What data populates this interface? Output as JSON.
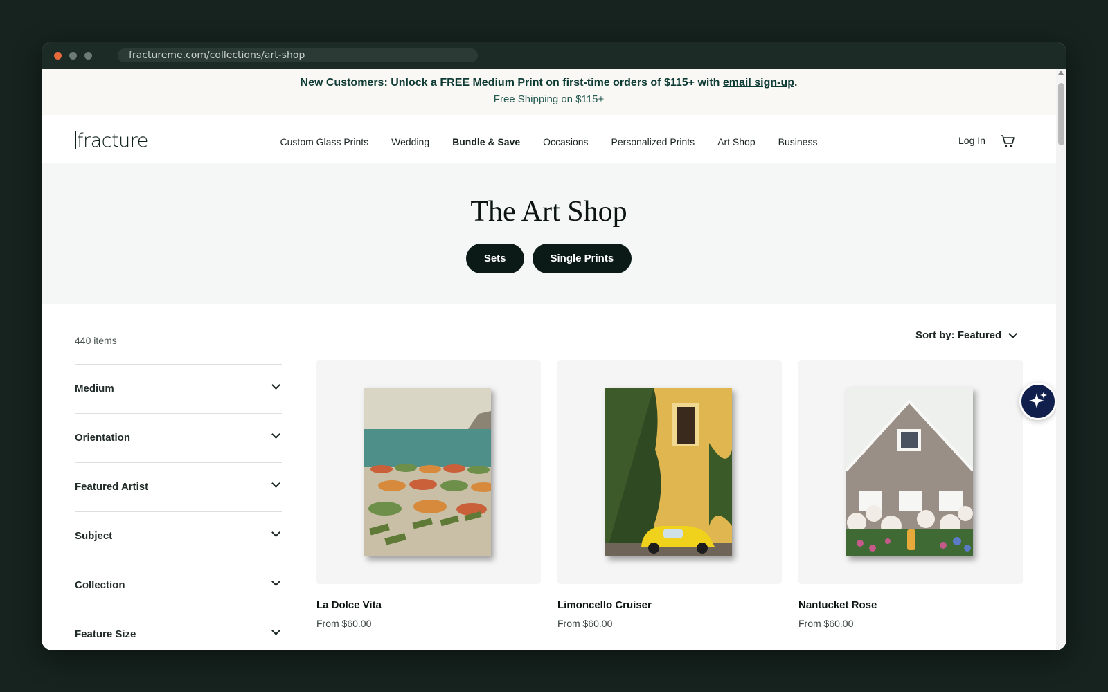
{
  "browser": {
    "url": "fractureme.com/collections/art-shop"
  },
  "promo": {
    "text_before": "New Customers: Unlock a FREE Medium Print on first-time orders of $115+ with ",
    "link": "email sign-up",
    "text_after": ".",
    "shipping": "Free Shipping on $115+"
  },
  "nav": {
    "logo": "fracture",
    "items": [
      {
        "label": "Custom Glass Prints"
      },
      {
        "label": "Wedding"
      },
      {
        "label": "Bundle & Save"
      },
      {
        "label": "Occasions"
      },
      {
        "label": "Personalized Prints"
      },
      {
        "label": "Art Shop"
      },
      {
        "label": "Business"
      }
    ],
    "login": "Log In",
    "cart_icon": "cart-icon"
  },
  "hero": {
    "title": "The Art Shop",
    "buttons": [
      "Sets",
      "Single Prints"
    ]
  },
  "listing": {
    "count": "440 items",
    "sort": "Sort by: Featured"
  },
  "filters": [
    "Medium",
    "Orientation",
    "Featured Artist",
    "Subject",
    "Collection",
    "Feature Size"
  ],
  "products": [
    {
      "title": "La Dolce Vita",
      "price": "From $60.00"
    },
    {
      "title": "Limoncello Cruiser",
      "price": "From $60.00"
    },
    {
      "title": "Nantucket Rose",
      "price": "From $60.00"
    }
  ],
  "colors": {
    "accent": "#0b1a16",
    "promo_text": "#0f3b35",
    "ai_button": "#111f4d"
  }
}
